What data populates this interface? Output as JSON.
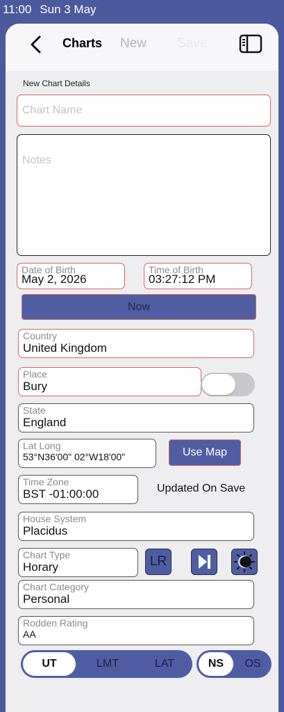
{
  "status_bar": {
    "time": "11:00",
    "date": "Sun 3 May"
  },
  "nav": {
    "back_icon": "chevron-left-icon",
    "title": "Charts",
    "new_label": "New",
    "save_label": "Save",
    "sidebar_icon": "sidebar-toggle-icon"
  },
  "form": {
    "section_title": "New Chart Details",
    "chart_name_placeholder": "Chart Name",
    "notes_placeholder": "Notes",
    "date_of_birth": {
      "label": "Date of Birth",
      "value": "May 2, 2026"
    },
    "time_of_birth": {
      "label": "Time of Birth",
      "value": "03:27:12 PM"
    },
    "now_label": "Now",
    "country": {
      "label": "Country",
      "value": "United Kingdom"
    },
    "place": {
      "label": "Place",
      "value": "Bury"
    },
    "place_toggle_on": false,
    "state": {
      "label": "State",
      "value": "England"
    },
    "lat_long": {
      "label": "Lat Long",
      "value": "53°N36'00\" 02°W18'00\""
    },
    "use_map_label": "Use Map",
    "time_zone": {
      "label": "Time Zone",
      "value": "BST -01:00:00"
    },
    "updated_note": "Updated On Save",
    "house_system": {
      "label": "House System",
      "value": "Placidus"
    },
    "chart_type": {
      "label": "Chart Type",
      "value": "Horary"
    },
    "lr_label": "LR",
    "skip_icon": "skip-forward-icon",
    "sun_icon": "sun-eclipse-icon",
    "chart_category": {
      "label": "Chart Category",
      "value": "Personal"
    },
    "rodden_rating": {
      "label": "Rodden Rating",
      "value": "AA"
    }
  },
  "time_mode": {
    "options": [
      "UT",
      "LMT",
      "LAT"
    ],
    "selected": "UT"
  },
  "node_mode": {
    "options": [
      "NS",
      "OS"
    ],
    "selected": "NS"
  },
  "colors": {
    "accent": "#4f5ea3",
    "error_border": "#d9665c",
    "background": "#4a5a9c"
  }
}
